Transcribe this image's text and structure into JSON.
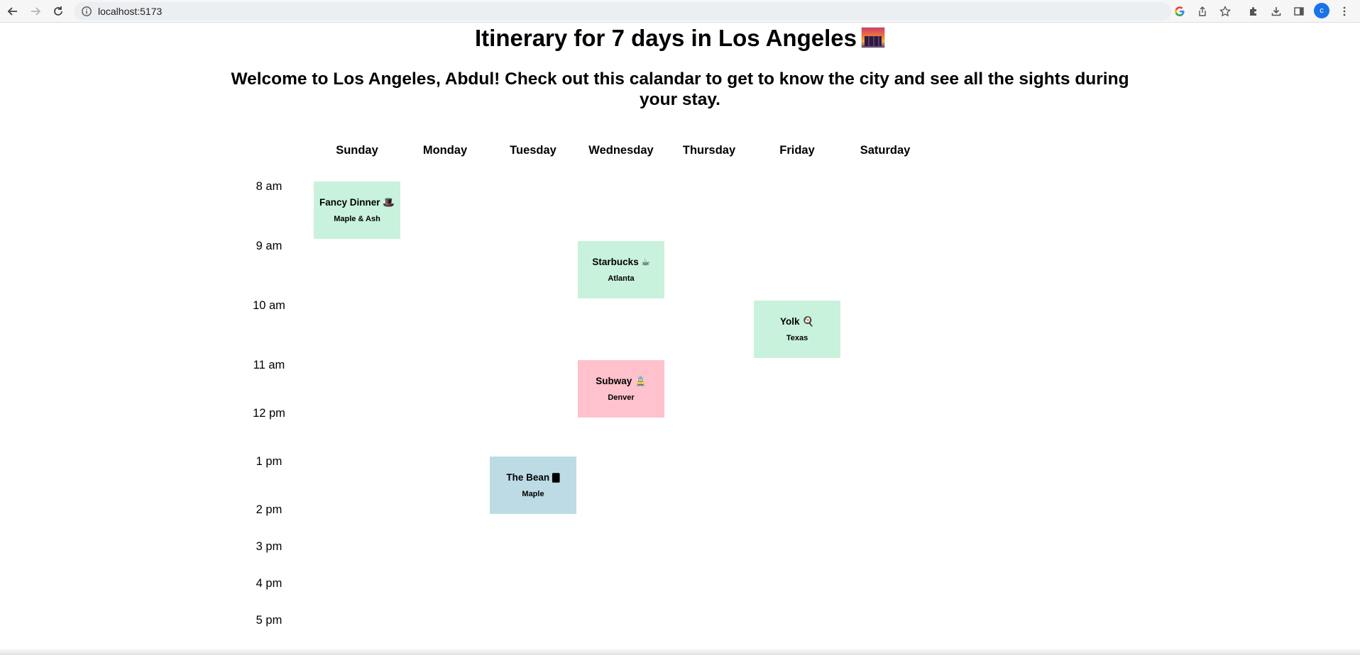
{
  "browser": {
    "url": "localhost:5173",
    "avatar_letter": "c",
    "avatar_color": "#1a73e8",
    "icons": [
      "back-arrow-icon",
      "forward-arrow-icon",
      "reload-icon",
      "info-icon",
      "google-icon",
      "share-icon",
      "star-icon",
      "extensions-icon",
      "download-icon",
      "side-panel-icon",
      "menu-icon"
    ]
  },
  "page": {
    "title": "Itinerary for 7 days in Los Angeles",
    "subtitle": "Welcome to Los Angeles, Abdul! Check out this calandar to get to know the city and see all the sights during your stay."
  },
  "calendar": {
    "days": [
      "Sunday",
      "Monday",
      "Tuesday",
      "Wednesday",
      "Thursday",
      "Friday",
      "Saturday"
    ],
    "times": [
      "8 am",
      "9 am",
      "10 am",
      "11 am",
      "12 pm",
      "1 pm",
      "2 pm",
      "3 pm",
      "4 pm",
      "5 pm"
    ],
    "events": [
      {
        "title": "Fancy Dinner 🎩",
        "location": "Maple & Ash",
        "day": "Sunday",
        "time": "8 am",
        "color": "#c8f2dc"
      },
      {
        "title": "Starbucks ☕",
        "location": "Atlanta",
        "day": "Wednesday",
        "time": "9 am",
        "color": "#c8f2dc"
      },
      {
        "title": "Yolk 🍳",
        "location": "Texas",
        "day": "Friday",
        "time": "10 am",
        "color": "#c8f2dc"
      },
      {
        "title": "Subway 🚊",
        "location": "Denver",
        "day": "Wednesday",
        "time": "11 am",
        "color": "#ffc1cc"
      },
      {
        "title": "The Bean 🀫",
        "location": "Maple",
        "day": "Tuesday",
        "time": "1 pm",
        "color": "#bddbe5"
      }
    ]
  }
}
